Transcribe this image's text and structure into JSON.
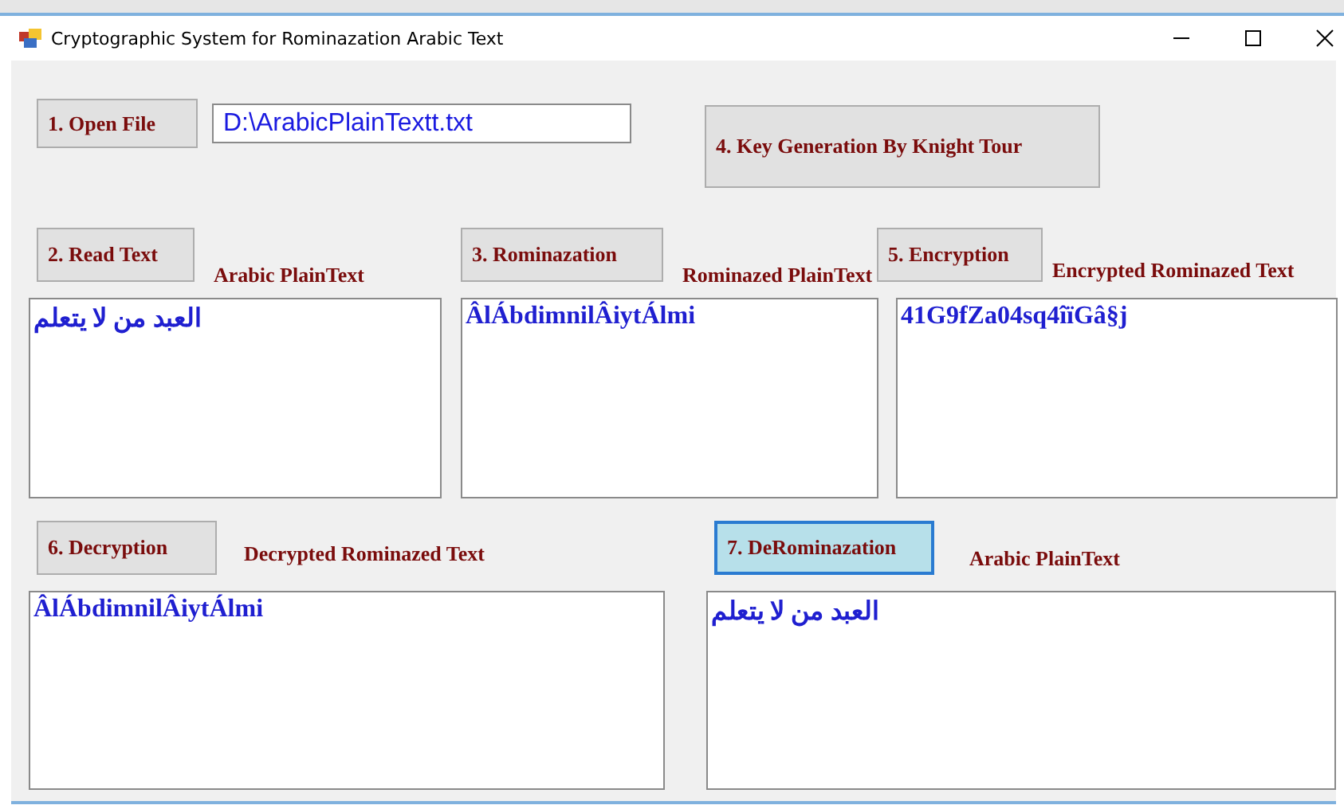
{
  "window": {
    "title": "Cryptographic System for Rominazation Arabic Text"
  },
  "open_file": {
    "button": {
      "label": "1. Open File",
      "focused": false
    },
    "path": "D:\\ArabicPlainTextt.txt"
  },
  "key_generation": {
    "button": {
      "label": "4. Key Generation By Knight Tour",
      "focused": false
    }
  },
  "row_1": [
    {
      "button": {
        "label": "2. Read Text",
        "focused": false
      },
      "caption": "Arabic PlainText",
      "text": "العبد من لا يتعلم"
    },
    {
      "button": {
        "label": "3. Rominazation",
        "focused": false
      },
      "caption": "Rominazed PlainText",
      "text": "ÂlÁbdimnilÂiytÁlmi"
    },
    {
      "button": {
        "label": "5. Encryption",
        "focused": false
      },
      "caption": "Encrypted Rominazed Text",
      "text": "41G9fZa04sq4îïGâ§j"
    }
  ],
  "row_2": [
    {
      "button": {
        "label": "6. Decryption",
        "focused": false
      },
      "caption": "Decrypted Rominazed Text",
      "text": "ÂlÁbdimnilÂiytÁlmi"
    },
    {
      "button": {
        "label": "7. DeRominazation",
        "focused": true
      },
      "caption": "Arabic PlainText",
      "text": "العبد من لا يتعلم"
    }
  ]
}
